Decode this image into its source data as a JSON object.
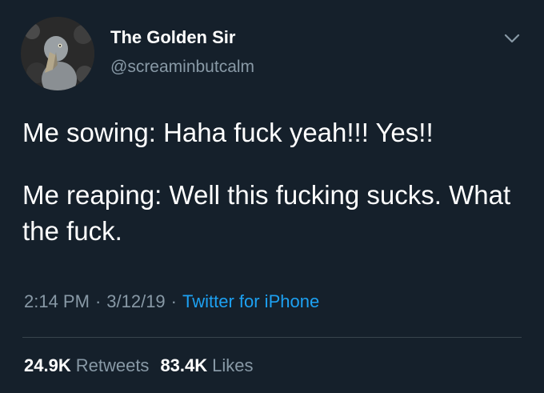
{
  "user": {
    "display_name": "The Golden Sir",
    "handle": "@screaminbutcalm",
    "avatar_icon": "shoebill-bird-avatar"
  },
  "tweet": {
    "line1": "Me sowing: Haha fuck yeah!!! Yes!!",
    "line2": "Me reaping: Well this fucking sucks. What the fuck."
  },
  "meta": {
    "time": "2:14 PM",
    "separator": "·",
    "date": "3/12/19",
    "source": "Twitter for iPhone"
  },
  "stats": {
    "retweets_count": "24.9K",
    "retweets_label": "Retweets",
    "likes_count": "83.4K",
    "likes_label": "Likes"
  },
  "colors": {
    "background": "#15202b",
    "secondary_text": "#8899a6",
    "link": "#1da1f2",
    "divider": "#38444d"
  }
}
